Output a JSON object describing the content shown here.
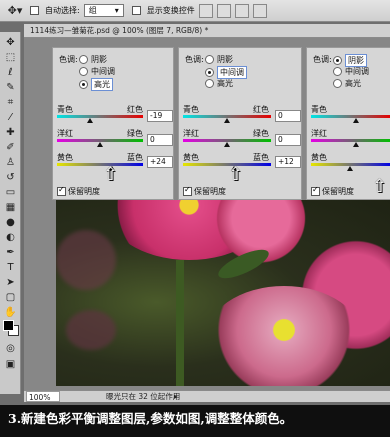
{
  "options_bar": {
    "auto_select_label": "自动选择:",
    "auto_select_value": "组",
    "show_transform_label": "显示变换控件"
  },
  "document": {
    "title": "1114练习—雏菊花.psd @ 100% (图层 7, RGB/8) *"
  },
  "panels": [
    {
      "tone_label": "色调:",
      "tone_options": [
        "阴影",
        "中间调",
        "高光"
      ],
      "tone_selected": 2,
      "sliders": [
        {
          "left": "青色",
          "right": "红色",
          "value": "-19"
        },
        {
          "left": "洋红",
          "right": "绿色",
          "value": "0"
        },
        {
          "left": "黄色",
          "right": "蓝色",
          "value": "+24"
        }
      ],
      "preserve_label": "保留明度"
    },
    {
      "tone_label": "色调:",
      "tone_options": [
        "阴影",
        "中间调",
        "高光"
      ],
      "tone_selected": 1,
      "sliders": [
        {
          "left": "青色",
          "right": "红色",
          "value": "0"
        },
        {
          "left": "洋红",
          "right": "绿色",
          "value": "0"
        },
        {
          "left": "黄色",
          "right": "蓝色",
          "value": "+12"
        }
      ],
      "preserve_label": "保留明度"
    },
    {
      "tone_label": "色调:",
      "tone_options": [
        "阴影",
        "中间调",
        "高光"
      ],
      "tone_selected": 0,
      "sliders": [
        {
          "left": "青色",
          "right": "",
          "value": ""
        },
        {
          "left": "洋红",
          "right": "",
          "value": ""
        },
        {
          "left": "黄色",
          "right": "",
          "value": ""
        }
      ],
      "preserve_label": "保留明度"
    }
  ],
  "status_bar": {
    "zoom": "100%",
    "info": "曝光只在 32 位起作用"
  },
  "caption": "3.新建色彩平衡调整图层,参数如图,调整整体颜色。"
}
